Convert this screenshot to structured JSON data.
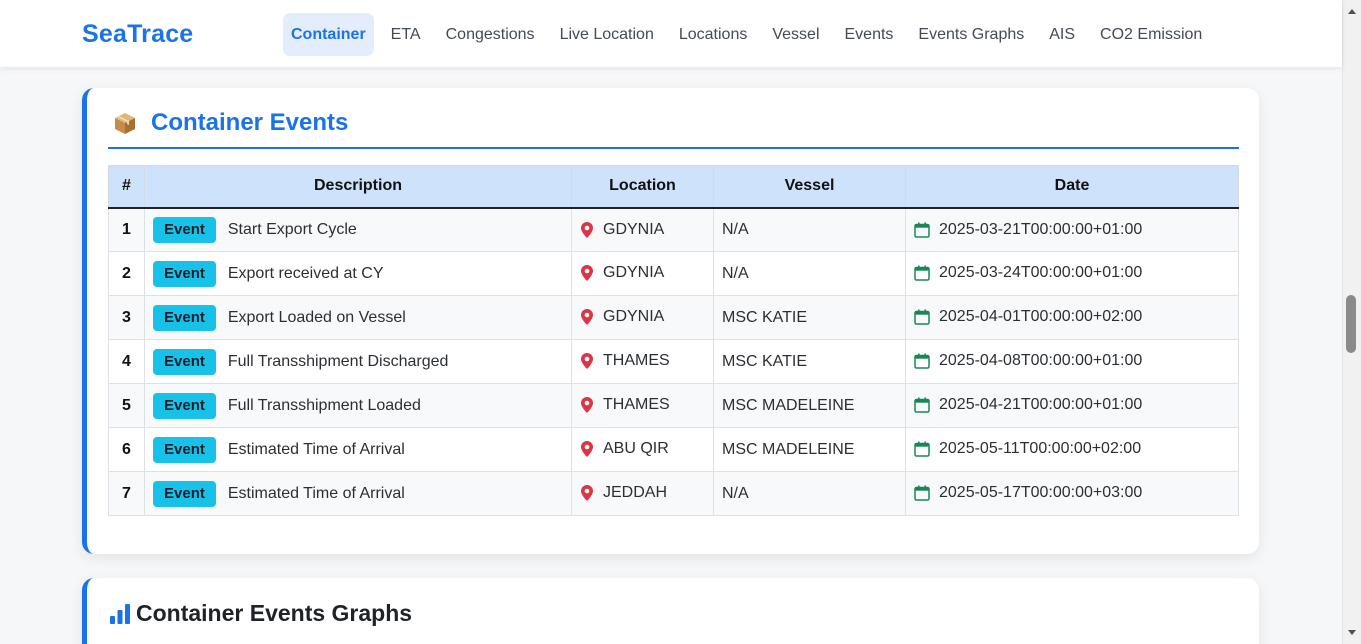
{
  "app": {
    "brand": "SeaTrace"
  },
  "nav": {
    "items": [
      {
        "label": "Container",
        "active": true
      },
      {
        "label": "ETA"
      },
      {
        "label": "Congestions"
      },
      {
        "label": "Live Location"
      },
      {
        "label": "Locations"
      },
      {
        "label": "Vessel"
      },
      {
        "label": "Events"
      },
      {
        "label": "Events Graphs"
      },
      {
        "label": "AIS"
      },
      {
        "label": "CO2 Emission"
      }
    ]
  },
  "events_card": {
    "title": "Container Events",
    "icon": "package-icon",
    "columns": [
      "#",
      "Description",
      "Location",
      "Vessel",
      "Date"
    ],
    "rows": [
      {
        "num": "1",
        "badge": "Event",
        "description": "Start Export Cycle",
        "location": "GDYNIA",
        "vessel": "N/A",
        "date": "2025-03-21T00:00:00+01:00"
      },
      {
        "num": "2",
        "badge": "Event",
        "description": "Export received at CY",
        "location": "GDYNIA",
        "vessel": "N/A",
        "date": "2025-03-24T00:00:00+01:00"
      },
      {
        "num": "3",
        "badge": "Event",
        "description": "Export Loaded on Vessel",
        "location": "GDYNIA",
        "vessel": "MSC KATIE",
        "date": "2025-04-01T00:00:00+02:00"
      },
      {
        "num": "4",
        "badge": "Event",
        "description": "Full Transshipment Discharged",
        "location": "THAMES",
        "vessel": "MSC KATIE",
        "date": "2025-04-08T00:00:00+01:00"
      },
      {
        "num": "5",
        "badge": "Event",
        "description": "Full Transshipment Loaded",
        "location": "THAMES",
        "vessel": "MSC MADELEINE",
        "date": "2025-04-21T00:00:00+01:00"
      },
      {
        "num": "6",
        "badge": "Event",
        "description": "Estimated Time of Arrival",
        "location": "ABU QIR",
        "vessel": "MSC MADELEINE",
        "date": "2025-05-11T00:00:00+02:00"
      },
      {
        "num": "7",
        "badge": "Event",
        "description": "Estimated Time of Arrival",
        "location": "JEDDAH",
        "vessel": "N/A",
        "date": "2025-05-17T00:00:00+03:00"
      }
    ]
  },
  "graphs_card": {
    "title": "Container Events Graphs",
    "icon": "bar-chart-icon"
  },
  "colors": {
    "accent": "#1a73e8",
    "badge": "#17c1e8",
    "pin": "#dc3545",
    "calendar": "#198754",
    "header_bg": "#cfe2fc"
  }
}
